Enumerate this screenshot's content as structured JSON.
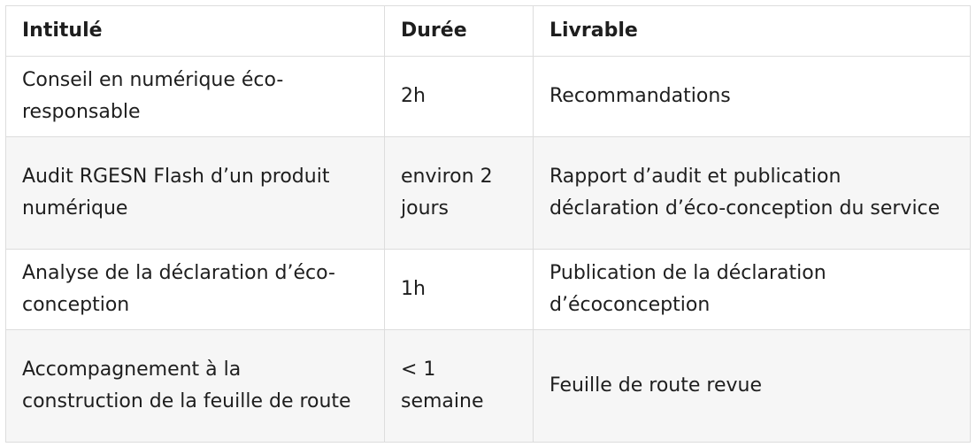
{
  "table": {
    "headers": [
      "Intitulé",
      "Durée",
      "Livrable"
    ],
    "rows": [
      [
        "Conseil en numérique éco-responsable",
        "2h",
        "Recommandations"
      ],
      [
        "Audit RGESN Flash d’un produit numérique",
        "environ 2 jours",
        "Rapport d’audit et publication déclaration d’éco-conception du service"
      ],
      [
        "Analyse de la déclaration d’éco-conception",
        "1h",
        "Publication de la déclaration d’écoconception"
      ],
      [
        "Accompagnement à la construction de la feuille de route",
        "< 1 semaine",
        "Feuille de route revue"
      ]
    ]
  }
}
